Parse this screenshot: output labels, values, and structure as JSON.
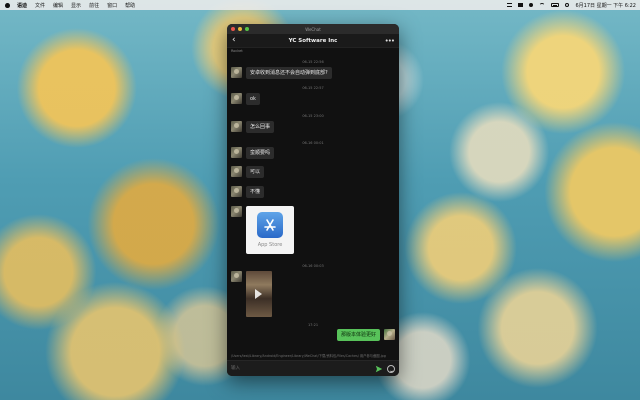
{
  "menubar": {
    "app_name": "语迪",
    "items": [
      "文件",
      "编辑",
      "显示",
      "前往",
      "窗口",
      "帮助"
    ],
    "clock": "6月17日 星期一 下午 6:22"
  },
  "window": {
    "title": "WeChat"
  },
  "chat": {
    "title": "YC Software Inc",
    "back_icon": "chevron-left-icon",
    "more_icon": "more-icon",
    "sender_name": "Rocket",
    "timestamps": [
      "06-15 22:56",
      "06-15 22:57",
      "06-15 23:00",
      "06-16 00:01",
      "06-16 00:03",
      "17:21"
    ],
    "messages": [
      {
        "from": "other",
        "type": "text",
        "text": "安卓收到消息还不会自动弹到底部?"
      },
      {
        "from": "other",
        "type": "text",
        "text": "ok"
      },
      {
        "from": "other",
        "type": "text",
        "text": "怎么回事"
      },
      {
        "from": "other",
        "type": "text",
        "text": "蛮顺要吗"
      },
      {
        "from": "other",
        "type": "text",
        "text": "可以"
      },
      {
        "from": "other",
        "type": "text",
        "text": "不懂"
      },
      {
        "from": "other",
        "type": "image",
        "label": "App Store"
      },
      {
        "from": "other",
        "type": "video"
      },
      {
        "from": "me",
        "type": "text",
        "text": "那版本体验更好"
      }
    ],
    "file_path": "/Users/test/Library/Android/Engineer/Library/WeChat/下载/资料包/Files/Caches/ 用户参与截图.jpg"
  },
  "input": {
    "placeholder": "输入",
    "send_icon": "send-icon",
    "emoji_icon": "emoji-icon"
  },
  "colors": {
    "my_bubble": "#58c25a",
    "other_bubble": "#2c2c2c",
    "window_bg": "#111111"
  }
}
